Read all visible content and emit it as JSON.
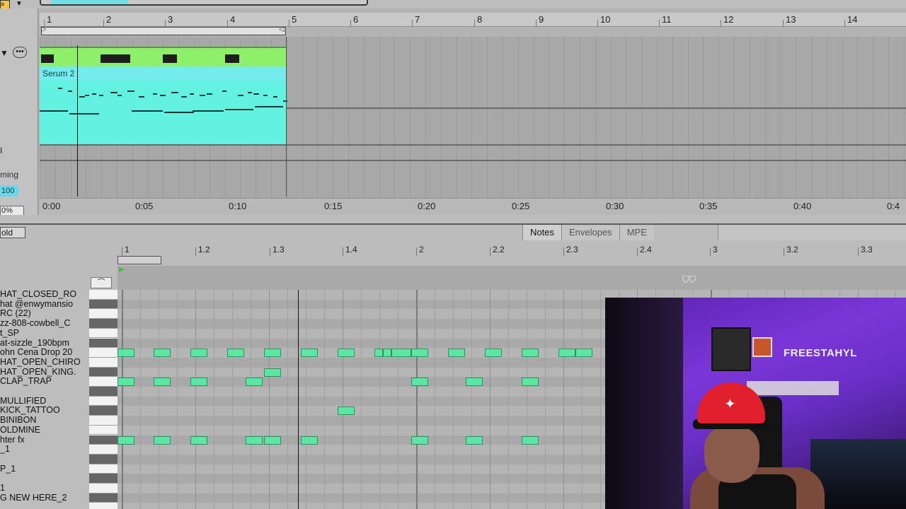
{
  "arrangement": {
    "bar_numbers": [
      "1",
      "2",
      "3",
      "4",
      "5",
      "6",
      "7",
      "8",
      "9",
      "10",
      "11",
      "12",
      "13",
      "14"
    ],
    "time_labels": [
      "0:00",
      "0:05",
      "0:10",
      "0:15",
      "0:20",
      "0:25",
      "0:30",
      "0:35",
      "0:40",
      "0:4"
    ],
    "clip_name": "Serum 2",
    "left_panel": {
      "timing_label": "ming",
      "value": "100",
      "percent": "0%",
      "letter": "I"
    }
  },
  "detail": {
    "fold_label": "old",
    "tabs": [
      "Notes",
      "Envelopes",
      "MPE"
    ],
    "active_tab": "Notes",
    "ruler": [
      "1",
      "1.2",
      "1.3",
      "1.4",
      "2",
      "2.2",
      "2.3",
      "2.4",
      "3",
      "3.2",
      "3.3"
    ],
    "drum_names": [
      "HAT_CLOSED_RO",
      "hat @enwymansio",
      "RC (22)",
      "zz-808-cowbell_C",
      "t_SP",
      "at-sizzle_190bpm",
      "ohn Cena Drop 20",
      "HAT_OPEN_CHIRO",
      "HAT_OPEN_KING.",
      "CLAP_TRAP",
      "",
      "MULLIFIED",
      "KICK_TATTOO",
      "BINIBON",
      "OLDMINE",
      "hter fx",
      "_1",
      "",
      "P_1",
      "",
      "1",
      "G NEW HERE_2"
    ]
  },
  "webcam": {
    "brand_text": "FREESTAHYL"
  },
  "colors": {
    "clip_green": "#8ef06a",
    "clip_cyan": "#63f2e1",
    "note_fill": "#5ce6a4"
  }
}
